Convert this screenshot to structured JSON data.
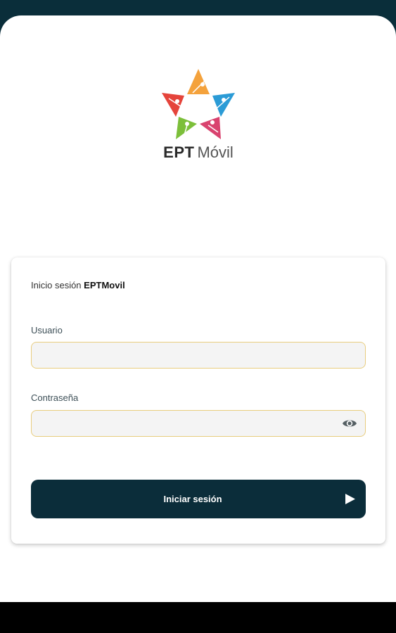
{
  "app": {
    "logo_name_bold": "EPT",
    "logo_name_light": "Móvil"
  },
  "login_card": {
    "title_prefix": "Inicio sesión",
    "title_brand": "EPTMovil",
    "username": {
      "label": "Usuario",
      "value": "",
      "placeholder": ""
    },
    "password": {
      "label": "Contraseña",
      "value": "",
      "placeholder": ""
    },
    "submit_label": "Iniciar sesión"
  },
  "icons": {
    "logo": "star-logo-icon",
    "password_toggle": "eye-icon",
    "submit": "play-icon"
  },
  "colors": {
    "header_background": "#0a2e3a",
    "button_background": "#0b2d3a",
    "field_border": "#e8cd7e",
    "field_background": "#f4f4f4",
    "logo_orange": "#f4a23c",
    "logo_blue": "#2b9bd6",
    "logo_magenta": "#d9436f",
    "logo_green": "#7cbf3a",
    "logo_red": "#e5443b"
  }
}
